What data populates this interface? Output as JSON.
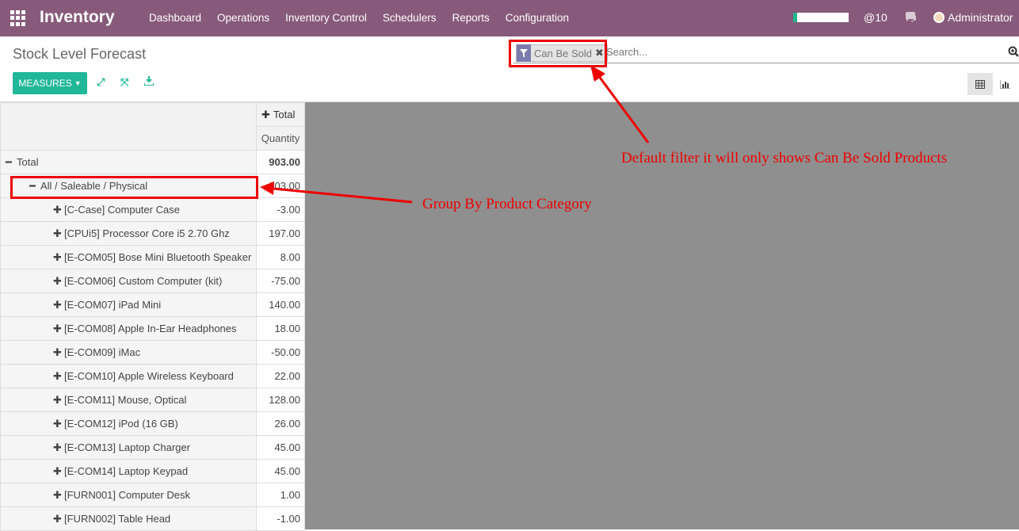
{
  "topbar": {
    "app_name": "Inventory",
    "menu": [
      "Dashboard",
      "Operations",
      "Inventory Control",
      "Schedulers",
      "Reports",
      "Configuration"
    ],
    "messages_count": "@10",
    "user": "Administrator"
  },
  "control_panel": {
    "title": "Stock Level Forecast",
    "facet_label": "Can Be Sold",
    "search_placeholder": "Search...",
    "measures_label": "MEASURES"
  },
  "pivot": {
    "col_header": "Total",
    "measure": "Quantity",
    "total_row": {
      "label": "Total",
      "value": "903.00"
    },
    "group_row": {
      "label": "All / Saleable / Physical",
      "value": "903.00"
    },
    "rows": [
      {
        "label": "[C-Case] Computer Case",
        "value": "-3.00"
      },
      {
        "label": "[CPUi5] Processor Core i5 2.70 Ghz",
        "value": "197.00"
      },
      {
        "label": "[E-COM05] Bose Mini Bluetooth Speaker",
        "value": "8.00"
      },
      {
        "label": "[E-COM06] Custom Computer (kit)",
        "value": "-75.00"
      },
      {
        "label": "[E-COM07] iPad Mini",
        "value": "140.00"
      },
      {
        "label": "[E-COM08] Apple In-Ear Headphones",
        "value": "18.00"
      },
      {
        "label": "[E-COM09] iMac",
        "value": "-50.00"
      },
      {
        "label": "[E-COM10] Apple Wireless Keyboard",
        "value": "22.00"
      },
      {
        "label": "[E-COM11] Mouse, Optical",
        "value": "128.00"
      },
      {
        "label": "[E-COM12] iPod (16 GB)",
        "value": "26.00"
      },
      {
        "label": "[E-COM13] Laptop Charger",
        "value": "45.00"
      },
      {
        "label": "[E-COM14] Laptop Keypad",
        "value": "45.00"
      },
      {
        "label": "[FURN001] Computer Desk",
        "value": "1.00"
      },
      {
        "label": "[FURN002] Table Head",
        "value": "-1.00"
      }
    ]
  },
  "annotations": {
    "filter_note": "Default filter it will only shows Can Be Sold Products",
    "group_note": "Group By Product Category"
  },
  "colors": {
    "topbar": "#875a7b",
    "accent": "#21b799",
    "annotation": "#e00000",
    "backdrop": "#8f8f8f"
  },
  "icons": [
    "apps-grid-icon",
    "chat-icon",
    "filter-icon",
    "close-icon",
    "search-icon",
    "expand-icon",
    "flip-axis-icon",
    "download-icon",
    "pivot-view-icon",
    "graph-view-icon",
    "plus-icon",
    "minus-icon"
  ]
}
